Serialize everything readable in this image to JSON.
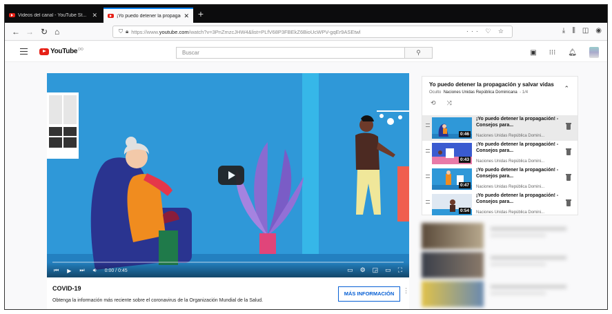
{
  "browser": {
    "tabs": [
      {
        "title": "Videos del canal - YouTube St...",
        "active": false
      },
      {
        "title": "¡Yo puedo detener la propagac...",
        "active": true
      }
    ],
    "new_tab": "+",
    "url_prefix": "https://www.",
    "url_domain": "youtube.com",
    "url_path": "/watch?v=3PnZmzcJHW4&list=PLfV68P3FBEkZ6BioUcWPV-gqEr9ASEtwl",
    "url_actions": "··· ♡ ☆"
  },
  "youtube": {
    "logo": "YouTube",
    "logo_region": "DO",
    "search_placeholder": "Buscar"
  },
  "player": {
    "time": "0:00 / 0:45",
    "progress": 0.0
  },
  "info": {
    "title": "COVID-19",
    "description": "Obtenga la información más reciente sobre el coronavirus de la Organización Mundial de la Salud.",
    "button": "MÁS INFORMACIÓN"
  },
  "playlist": {
    "title": "Yo puedo detener la propagación y salvar vidas",
    "visibility": "Oculto",
    "channel": "Naciones Unidas República Dominicana",
    "position": "1/4",
    "items": [
      {
        "title": "¡Yo puedo detener la propagación! - Consejos para...",
        "channel": "Naciones Unidas República Domini...",
        "duration": "0:46"
      },
      {
        "title": "¡Yo puedo detener la propagación! - Consejos para...",
        "channel": "Naciones Unidas República Domini...",
        "duration": "0:43"
      },
      {
        "title": "¡Yo puedo detener la propagación! - Consejos para...",
        "channel": "Naciones Unidas República Domini...",
        "duration": "0:47"
      },
      {
        "title": "¡Yo puedo detener la propagación! - Consejos para...",
        "channel": "Naciones Unidas República Domini...",
        "duration": "0:54"
      }
    ]
  }
}
